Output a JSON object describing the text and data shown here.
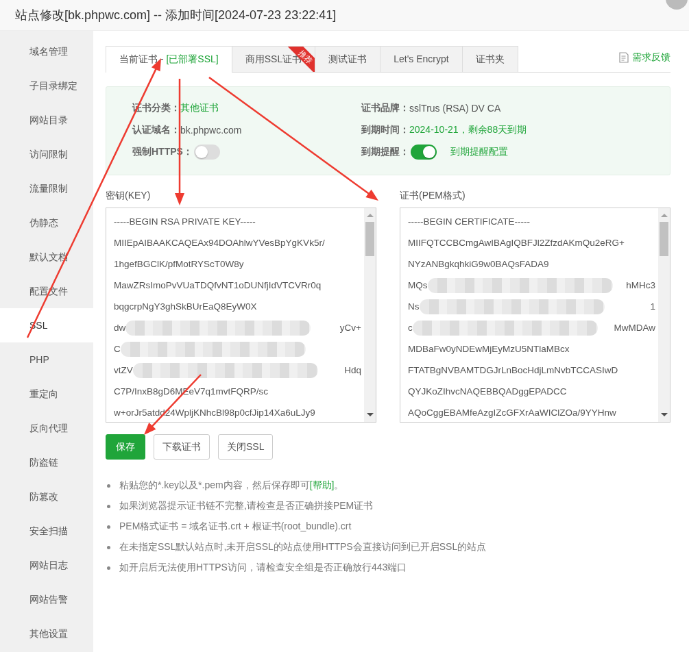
{
  "window": {
    "title": "站点修改[bk.phpwc.com] -- 添加时间[2024-07-23 23:22:41]"
  },
  "sidebar": {
    "items": [
      {
        "label": "域名管理",
        "selected": false
      },
      {
        "label": "子目录绑定",
        "selected": false
      },
      {
        "label": "网站目录",
        "selected": false
      },
      {
        "label": "访问限制",
        "selected": false
      },
      {
        "label": "流量限制",
        "selected": false
      },
      {
        "label": "伪静态",
        "selected": false
      },
      {
        "label": "默认文档",
        "selected": false
      },
      {
        "label": "配置文件",
        "selected": false
      },
      {
        "label": "SSL",
        "selected": true
      },
      {
        "label": "PHP",
        "selected": false
      },
      {
        "label": "重定向",
        "selected": false
      },
      {
        "label": "反向代理",
        "selected": false
      },
      {
        "label": "防盗链",
        "selected": false
      },
      {
        "label": "防篡改",
        "selected": false
      },
      {
        "label": "安全扫描",
        "selected": false
      },
      {
        "label": "网站日志",
        "selected": false
      },
      {
        "label": "网站告警",
        "selected": false
      },
      {
        "label": "其他设置",
        "selected": false
      }
    ]
  },
  "tabs": [
    {
      "label": "当前证书 - ",
      "status": "[已部署SSL]",
      "selected": true
    },
    {
      "label": "商用SSL证书",
      "badge": "推荐",
      "selected": false
    },
    {
      "label": "测试证书",
      "selected": false
    },
    {
      "label": "Let's Encrypt",
      "selected": false
    },
    {
      "label": "证书夹",
      "selected": false
    }
  ],
  "feedback_link": "需求反馈",
  "cert_info": {
    "left": [
      {
        "label": "证书分类：",
        "value": "其他证书",
        "kind": "highlight"
      },
      {
        "label": "认证域名：",
        "value": "bk.phpwc.com",
        "kind": "text"
      },
      {
        "label": "强制HTTPS：",
        "kind": "toggle",
        "on": false
      }
    ],
    "right": [
      {
        "label": "证书品牌：",
        "value": "sslTrus (RSA) DV CA",
        "kind": "text"
      },
      {
        "label": "到期时间：",
        "value": "2024-10-21，剩余88天到期",
        "kind": "highlight"
      },
      {
        "label": "到期提醒：",
        "kind": "toggle",
        "on": true,
        "link": "到期提醒配置"
      }
    ]
  },
  "key_box": {
    "label": "密钥(KEY)",
    "lines": [
      {
        "text": "-----BEGIN RSA PRIVATE KEY-----"
      },
      {
        "text": "MIIEpAIBAAKCAQEAx94DOAhlwYVesBpYgKVk5r/"
      },
      {
        "text": "1hgefBGClK/pfMotRYScT0W8y"
      },
      {
        "text": "MawZRsImoPvVUaTDQfvNT1oDUNfjIdVTCVRr0q"
      },
      {
        "text": "bqgcrpNgY3ghSkBUrEaQ8EyW0X"
      },
      {
        "text": "dw",
        "tail": "yCv+",
        "blurred": true
      },
      {
        "text": "C",
        "blurred": true
      },
      {
        "text": "vtZV",
        "tail": "Hdq",
        "blurred": true
      },
      {
        "text": "C7P/InxB8gD6MEeV7q1mvtFQRP/sc"
      },
      {
        "text": "w+orJr5atdd24WpljKNhcBl98p0cfJip14Xa6uLJy9"
      }
    ]
  },
  "cert_box": {
    "label": "证书(PEM格式)",
    "lines": [
      {
        "text": "-----BEGIN CERTIFICATE-----"
      },
      {
        "text": "MIIFQTCCBCmgAwIBAgIQBFJl2ZfzdAKmQu2eRG+"
      },
      {
        "text": "NYzANBgkqhkiG9w0BAQsFADA9"
      },
      {
        "text": "MQs",
        "tail": "hMHc3",
        "blurred": true
      },
      {
        "text": "Ns",
        "tail": "1",
        "blurred": true
      },
      {
        "text": "c",
        "tail": "MwMDAw",
        "blurred": true
      },
      {
        "text": "MDBaFw0yNDEwMjEyMzU5NTlaMBcx"
      },
      {
        "text": "FTATBgNVBAMTDGJrLnBocHdjLmNvbTCCASIwD"
      },
      {
        "text": "QYJKoZIhvcNAQEBBQADggEPADCC"
      },
      {
        "text": "AQoCggEBAMfeAzgIZcGFXrAaWIClZOa/9YYHnw"
      }
    ]
  },
  "buttons": [
    {
      "label": "保存",
      "kind": "primary"
    },
    {
      "label": "下载证书",
      "kind": "default"
    },
    {
      "label": "关闭SSL",
      "kind": "default"
    }
  ],
  "tips": [
    {
      "text": "粘贴您的*.key以及*.pem内容，然后保存即可",
      "link": "[帮助]",
      "after": "。"
    },
    {
      "text": "如果浏览器提示证书链不完整,请检查是否正确拼接PEM证书"
    },
    {
      "text": "PEM格式证书 = 域名证书.crt + 根证书(root_bundle).crt"
    },
    {
      "text": "在未指定SSL默认站点时,未开启SSL的站点使用HTTPS会直接访问到已开启SSL的站点"
    },
    {
      "text": "如开启后无法使用HTTPS访问，请检查安全组是否正确放行443端口"
    }
  ]
}
